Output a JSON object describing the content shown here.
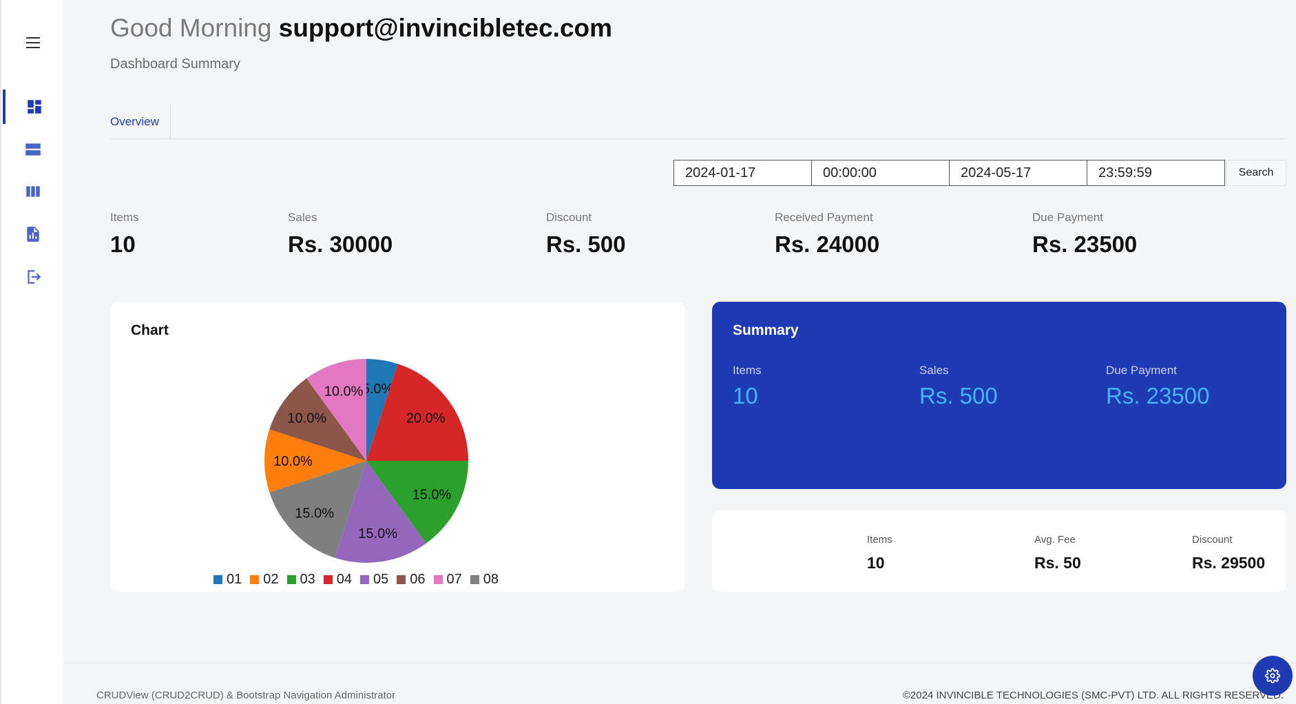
{
  "greeting": {
    "prefix": "Good Morning",
    "email": "support@invincibletec.com"
  },
  "subtitle": "Dashboard Summary",
  "tabs": [
    {
      "label": "Overview",
      "active": true
    }
  ],
  "filters": {
    "from_date": "2024-01-17",
    "from_time": "00:00:00",
    "to_date": "2024-05-17",
    "to_time": "23:59:59",
    "search_label": "Search"
  },
  "stats": [
    {
      "label": "Items",
      "value": "10"
    },
    {
      "label": "Sales",
      "value": "Rs. 30000"
    },
    {
      "label": "Discount",
      "value": "Rs. 500"
    },
    {
      "label": "Received Payment",
      "value": "Rs. 24000"
    },
    {
      "label": "Due Payment",
      "value": "Rs. 23500"
    }
  ],
  "chart": {
    "title": "Chart",
    "chart_data": {
      "type": "pie",
      "categories": [
        "01",
        "02",
        "03",
        "04",
        "05",
        "06",
        "07",
        "08"
      ],
      "values": [
        5.0,
        10.0,
        15.0,
        20.0,
        15.0,
        10.0,
        10.0,
        15.0
      ],
      "colors": [
        "#1f77b4",
        "#ff7f0e",
        "#2ca02c",
        "#d62728",
        "#9467bd",
        "#8c564b",
        "#e377c2",
        "#7f7f7f"
      ],
      "start_angle_deg": 0,
      "direction": "clockwise",
      "order": [
        "01",
        "04",
        "03",
        "05",
        "08",
        "02",
        "06",
        "07"
      ],
      "legend_position": "bottom"
    }
  },
  "summary": {
    "title": "Summary",
    "items": [
      {
        "label": "Items",
        "value": "10"
      },
      {
        "label": "Sales",
        "value": "Rs. 500"
      },
      {
        "label": "Due Payment",
        "value": "Rs. 23500"
      }
    ]
  },
  "mini": [
    {
      "label": "Items",
      "value": "10"
    },
    {
      "label": "Avg. Fee",
      "value": "Rs. 50"
    },
    {
      "label": "Discount",
      "value": "Rs. 29500"
    }
  ],
  "footer": {
    "left": "CRUDView (CRUD2CRUD) & Bootstrap Navigation Administrator",
    "right": "©2024 INVINCIBLE TECHNOLOGIES (SMC-PVT) LTD. ALL RIGHTS RESERVED."
  },
  "icons": {
    "menu": "hamburger-menu-icon",
    "nav": [
      "dashboard-icon",
      "rows-icon",
      "columns-icon",
      "report-icon",
      "logout-icon"
    ],
    "settings": "gear-icon"
  },
  "colors": {
    "accent": "#1f3bb3",
    "summary_value": "#46b3ff"
  }
}
